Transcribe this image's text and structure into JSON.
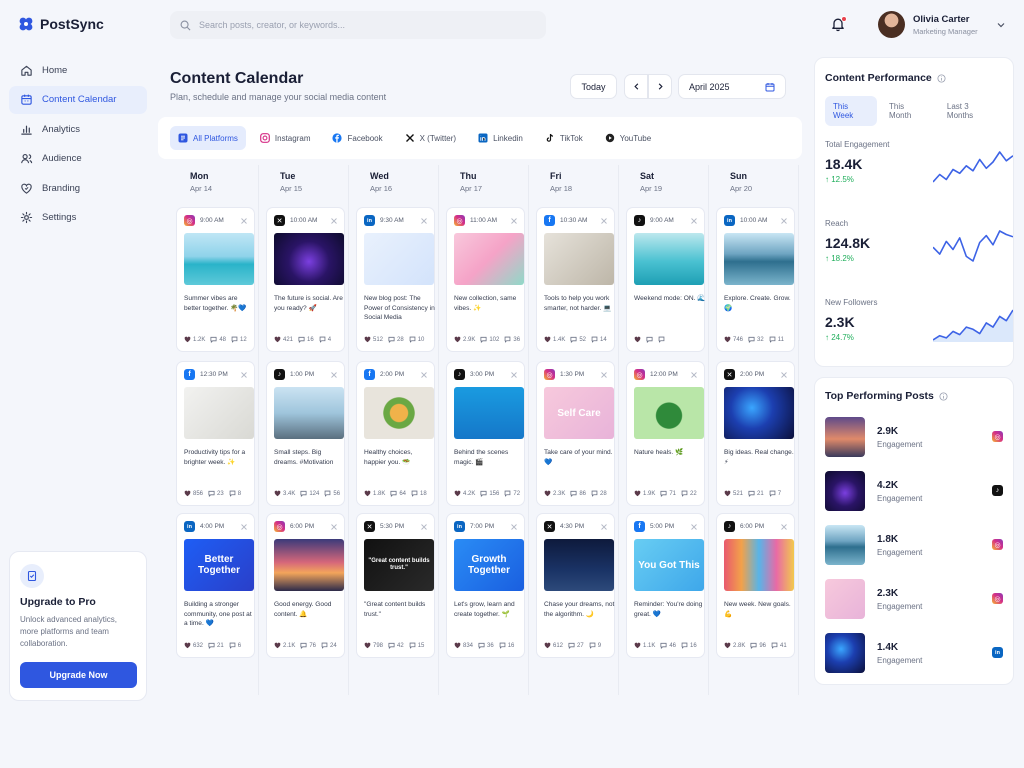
{
  "app": {
    "name": "PostSync"
  },
  "search": {
    "placeholder": "Search posts, creator, or keywords..."
  },
  "user": {
    "name": "Olivia Carter",
    "role": "Marketing Manager"
  },
  "nav": [
    {
      "label": "Home",
      "icon": "home-icon",
      "active": false
    },
    {
      "label": "Content Calendar",
      "icon": "calendar-icon",
      "active": true
    },
    {
      "label": "Analytics",
      "icon": "bar-chart-icon",
      "active": false
    },
    {
      "label": "Audience",
      "icon": "users-icon",
      "active": false
    },
    {
      "label": "Branding",
      "icon": "heart-icon",
      "active": false
    },
    {
      "label": "Settings",
      "icon": "gear-icon",
      "active": false
    }
  ],
  "promo": {
    "title": "Upgrade to Pro",
    "description": "Unlock advanced analytics, more platforms and team collaboration.",
    "button": "Upgrade Now"
  },
  "header": {
    "title": "Content Calendar",
    "subtitle": "Plan, schedule and manage your social media content",
    "today": "Today",
    "month": "April 2025"
  },
  "filters": [
    {
      "label": "All Platforms",
      "icon": "all-platforms-icon",
      "active": true
    },
    {
      "label": "Instagram",
      "icon": "instagram-icon",
      "active": false
    },
    {
      "label": "Facebook",
      "icon": "facebook-icon",
      "active": false
    },
    {
      "label": "X (Twitter)",
      "icon": "x-icon",
      "active": false
    },
    {
      "label": "Linkedin",
      "icon": "linkedin-icon",
      "active": false
    },
    {
      "label": "TikTok",
      "icon": "tiktok-icon",
      "active": false
    },
    {
      "label": "YouTube",
      "icon": "youtube-icon",
      "active": false
    }
  ],
  "days": [
    {
      "name": "Mon",
      "date": "Apr 14"
    },
    {
      "name": "Tue",
      "date": "Apr 15"
    },
    {
      "name": "Wed",
      "date": "Apr 16"
    },
    {
      "name": "Thu",
      "date": "Apr 17"
    },
    {
      "name": "Fri",
      "date": "Apr 18"
    },
    {
      "name": "Sat",
      "date": "Apr 19"
    },
    {
      "name": "Sun",
      "date": "Apr 20"
    }
  ],
  "colors": {
    "accent": "#2f57e0",
    "positive": "#1fae5b",
    "instagram": "#d62f86",
    "facebook": "#1877f2",
    "x": "#111111",
    "linkedin": "#0a66c2",
    "tiktok": "#111111"
  },
  "posts": [
    [
      {
        "platform": "instagram",
        "time": "9:00 AM",
        "text": "Summer vibes are better together. 🌴💙",
        "likes": "1.2K",
        "comments": "48",
        "shares": "12",
        "art": "beach",
        "overlay": ""
      },
      {
        "platform": "facebook",
        "time": "12:30 PM",
        "text": "Productivity tips for a brighter week. ✨",
        "likes": "856",
        "comments": "23",
        "shares": "8",
        "art": "desk",
        "overlay": ""
      },
      {
        "platform": "linkedin",
        "time": "4:00 PM",
        "text": "Building a stronger community, one post at a time. 💙",
        "likes": "632",
        "comments": "21",
        "shares": "6",
        "art": "blue-text",
        "overlay": "Better Together"
      }
    ],
    [
      {
        "platform": "x",
        "time": "10:00 AM",
        "text": "The future is social. Are you ready? 🚀",
        "likes": "421",
        "comments": "16",
        "shares": "4",
        "art": "neon-text",
        "overlay": ""
      },
      {
        "platform": "tiktok",
        "time": "1:00 PM",
        "text": "Small steps. Big dreams. #Motivation",
        "likes": "3.4K",
        "comments": "124",
        "shares": "56",
        "art": "people",
        "overlay": ""
      },
      {
        "platform": "instagram",
        "time": "6:00 PM",
        "text": "Good energy. Good content. 🔔",
        "likes": "2.1K",
        "comments": "76",
        "shares": "24",
        "art": "sunset",
        "overlay": ""
      }
    ],
    [
      {
        "platform": "linkedin",
        "time": "9:30 AM",
        "text": "New blog post: The Power of Consistency in Social Media",
        "likes": "512",
        "comments": "28",
        "shares": "10",
        "art": "illustration",
        "overlay": ""
      },
      {
        "platform": "facebook",
        "time": "2:00 PM",
        "text": "Healthy choices, happier you. 🥗",
        "likes": "1.8K",
        "comments": "64",
        "shares": "18",
        "art": "food",
        "overlay": ""
      },
      {
        "platform": "x",
        "time": "5:30 PM",
        "text": "\"Great content builds trust.\"",
        "likes": "798",
        "comments": "42",
        "shares": "15",
        "art": "quote",
        "overlay": "\"Great content builds trust.\""
      }
    ],
    [
      {
        "platform": "instagram",
        "time": "11:00 AM",
        "text": "New collection, same vibes. ✨",
        "likes": "2.9K",
        "comments": "102",
        "shares": "36",
        "art": "pink-shapes",
        "overlay": ""
      },
      {
        "platform": "tiktok",
        "time": "3:00 PM",
        "text": "Behind the scenes magic. 🎬",
        "likes": "4.2K",
        "comments": "156",
        "shares": "72",
        "art": "blue-person",
        "overlay": ""
      },
      {
        "platform": "linkedin",
        "time": "7:00 PM",
        "text": "Let's grow, learn and create together. 🌱",
        "likes": "834",
        "comments": "36",
        "shares": "16",
        "art": "blue-text2",
        "overlay": "Growth Together"
      }
    ],
    [
      {
        "platform": "facebook",
        "time": "10:30 AM",
        "text": "Tools to help you work smarter, not harder. 💻",
        "likes": "1.4K",
        "comments": "52",
        "shares": "14",
        "art": "laptop",
        "overlay": ""
      },
      {
        "platform": "instagram",
        "time": "1:30 PM",
        "text": "Take care of your mind. 💙",
        "likes": "2.3K",
        "comments": "86",
        "shares": "28",
        "art": "selfcare",
        "overlay": "Self Care"
      },
      {
        "platform": "x",
        "time": "4:30 PM",
        "text": "Chase your dreams, not the algorithm. 🌙",
        "likes": "612",
        "comments": "27",
        "shares": "9",
        "art": "night",
        "overlay": ""
      }
    ],
    [
      {
        "platform": "tiktok",
        "time": "9:00 AM",
        "text": "Weekend mode: ON. 🌊",
        "likes": "",
        "comments": "",
        "shares": "",
        "art": "pool",
        "overlay": ""
      },
      {
        "platform": "instagram",
        "time": "12:00 PM",
        "text": "Nature heals. 🌿",
        "likes": "1.9K",
        "comments": "71",
        "shares": "22",
        "art": "leaf",
        "overlay": ""
      },
      {
        "platform": "facebook",
        "time": "5:00 PM",
        "text": "Reminder: You're doing great. 💙",
        "likes": "1.1K",
        "comments": "46",
        "shares": "16",
        "art": "sky-text",
        "overlay": "You Got This"
      }
    ],
    [
      {
        "platform": "linkedin",
        "time": "10:00 AM",
        "text": "Explore. Create. Grow. 🌍",
        "likes": "746",
        "comments": "32",
        "shares": "11",
        "art": "lake",
        "overlay": ""
      },
      {
        "platform": "x",
        "time": "2:00 PM",
        "text": "Big ideas. Real change. ⚡",
        "likes": "521",
        "comments": "21",
        "shares": "7",
        "art": "galaxy",
        "overlay": ""
      },
      {
        "platform": "tiktok",
        "time": "6:00 PM",
        "text": "New week. New goals. 💪",
        "likes": "2.8K",
        "comments": "96",
        "shares": "41",
        "art": "buildings",
        "overlay": ""
      }
    ]
  ],
  "performance": {
    "title": "Content Performance",
    "tabs": [
      {
        "label": "This Week",
        "active": true
      },
      {
        "label": "This Month",
        "active": false
      },
      {
        "label": "Last 3 Months",
        "active": false
      }
    ],
    "metrics": [
      {
        "label": "Total Engagement",
        "value": "18.4K",
        "change": "↑ 12.5%",
        "trend": [
          20,
          26,
          22,
          30,
          27,
          33,
          29,
          38,
          31,
          36,
          44,
          37,
          41
        ]
      },
      {
        "label": "Reach",
        "value": "124.8K",
        "change": "↑ 18.2%",
        "trend": [
          30,
          24,
          35,
          28,
          38,
          22,
          18,
          34,
          40,
          32,
          44,
          41,
          39
        ]
      },
      {
        "label": "New Followers",
        "value": "2.3K",
        "change": "↑ 24.7%",
        "trend": [
          12,
          16,
          14,
          20,
          17,
          24,
          22,
          18,
          28,
          24,
          34,
          30,
          40
        ]
      }
    ]
  },
  "top_posts": {
    "title": "Top Performing Posts",
    "items": [
      {
        "value": "2.9K",
        "label": "Engagement",
        "platform": "instagram",
        "art": "beach-sunset"
      },
      {
        "value": "4.2K",
        "label": "Engagement",
        "platform": "tiktok",
        "art": "neon-text"
      },
      {
        "value": "1.8K",
        "label": "Engagement",
        "platform": "instagram",
        "art": "lake"
      },
      {
        "value": "2.3K",
        "label": "Engagement",
        "platform": "instagram",
        "art": "selfcare"
      },
      {
        "value": "1.4K",
        "label": "Engagement",
        "platform": "linkedin",
        "art": "galaxy"
      }
    ]
  }
}
